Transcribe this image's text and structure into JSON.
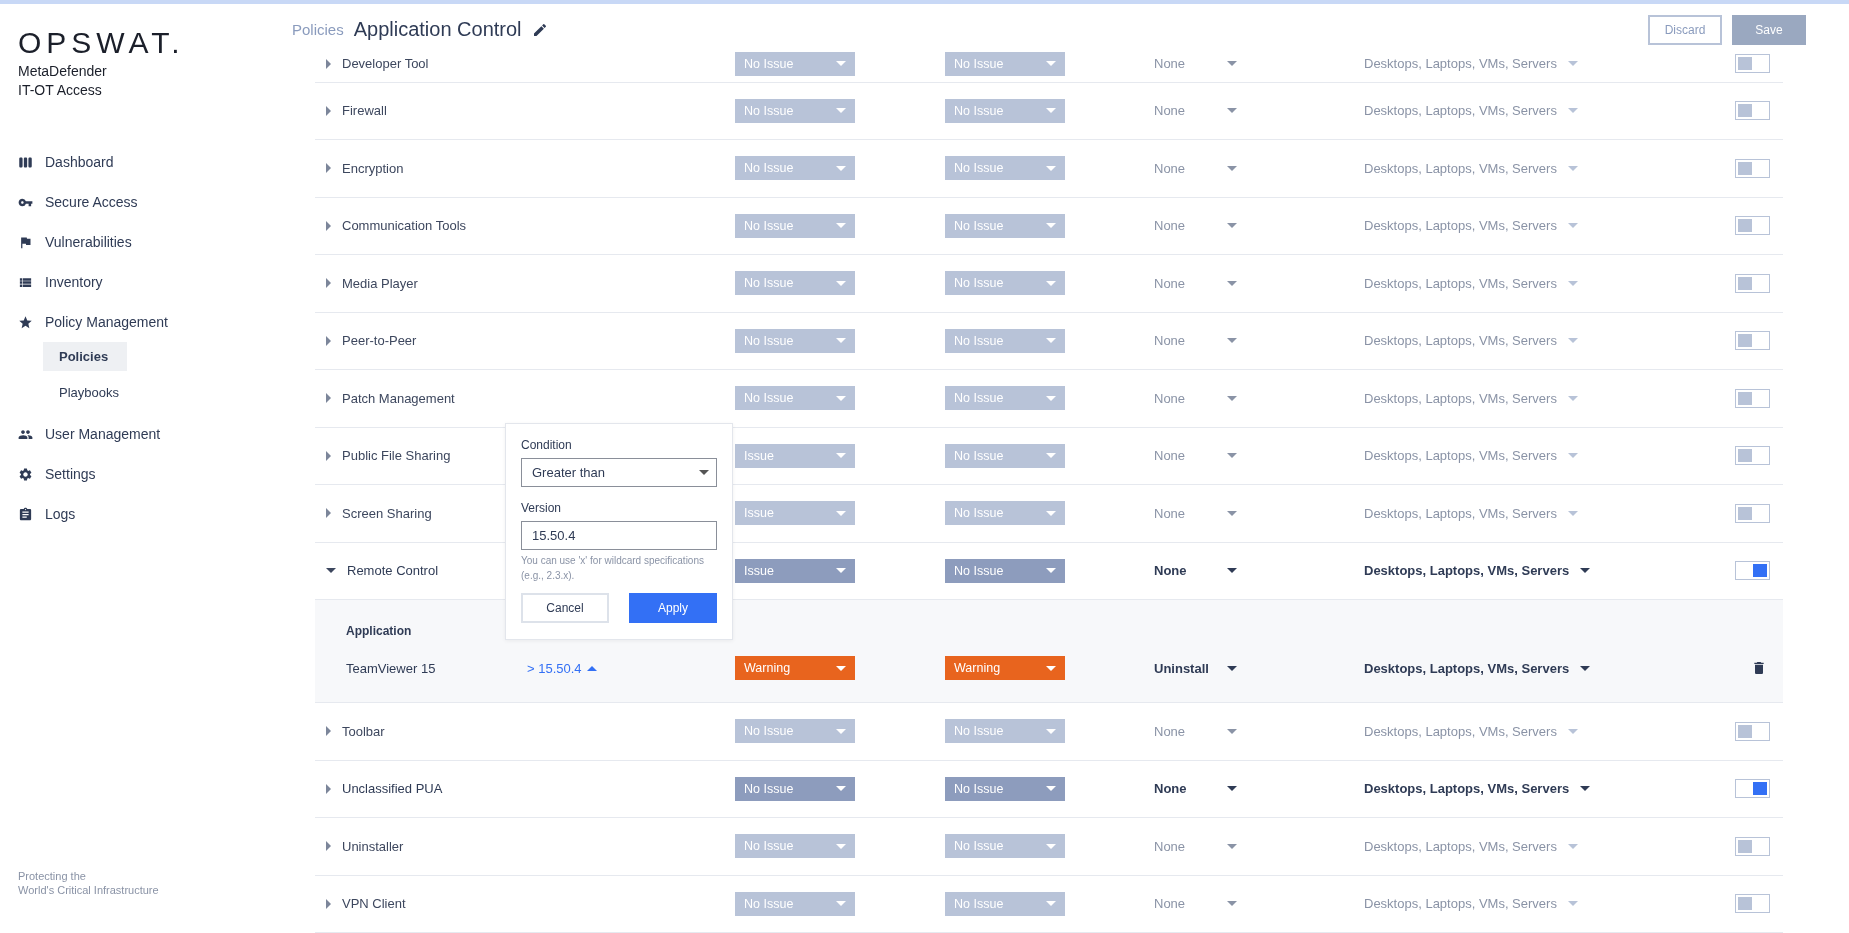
{
  "sidebar": {
    "logo": "OPSWAT.",
    "product": [
      "MetaDefender",
      "IT-OT Access"
    ],
    "nav": [
      {
        "label": "Dashboard",
        "selected": false
      },
      {
        "label": "Secure Access",
        "selected": false
      },
      {
        "label": "Vulnerabilities",
        "selected": false
      },
      {
        "label": "Inventory",
        "selected": false
      },
      {
        "label": "Policy Management",
        "selected": false,
        "children": [
          {
            "label": "Policies",
            "selected": true
          },
          {
            "label": "Playbooks",
            "selected": false
          }
        ]
      },
      {
        "label": "User Management",
        "selected": false
      },
      {
        "label": "Settings",
        "selected": false
      },
      {
        "label": "Logs",
        "selected": false
      }
    ],
    "footer": [
      "Protecting the",
      "World's Critical Infrastructure"
    ]
  },
  "header": {
    "breadcrumb": "Policies",
    "title": "Application Control",
    "buttons": [
      {
        "label": "Discard",
        "disabled": false
      },
      {
        "label": "Save",
        "disabled": true
      }
    ]
  },
  "rows": [
    {
      "name": "Developer Tool",
      "expanded": false,
      "on": false,
      "severity": [
        {
          "label": "No Issue",
          "kind": "ok"
        },
        {
          "label": "No Issue",
          "kind": "ok"
        }
      ],
      "action": "None",
      "platforms": "Desktops, Laptops, VMs, Servers"
    },
    {
      "name": "Firewall",
      "expanded": false,
      "on": false,
      "severity": [
        {
          "label": "No Issue",
          "kind": "ok"
        },
        {
          "label": "No Issue",
          "kind": "ok"
        }
      ],
      "action": "None",
      "platforms": "Desktops, Laptops, VMs, Servers"
    },
    {
      "name": "Encryption",
      "expanded": false,
      "on": false,
      "severity": [
        {
          "label": "No Issue",
          "kind": "ok"
        },
        {
          "label": "No Issue",
          "kind": "ok"
        }
      ],
      "action": "None",
      "platforms": "Desktops, Laptops, VMs, Servers"
    },
    {
      "name": "Communication Tools",
      "expanded": false,
      "on": false,
      "severity": [
        {
          "label": "No Issue",
          "kind": "ok"
        },
        {
          "label": "No Issue",
          "kind": "ok"
        }
      ],
      "action": "None",
      "platforms": "Desktops, Laptops, VMs, Servers"
    },
    {
      "name": "Media Player",
      "expanded": false,
      "on": false,
      "severity": [
        {
          "label": "No Issue",
          "kind": "ok"
        },
        {
          "label": "No Issue",
          "kind": "ok"
        }
      ],
      "action": "None",
      "platforms": "Desktops, Laptops, VMs, Servers"
    },
    {
      "name": "Peer-to-Peer",
      "expanded": false,
      "on": false,
      "severity": [
        {
          "label": "No Issue",
          "kind": "ok"
        },
        {
          "label": "No Issue",
          "kind": "ok"
        }
      ],
      "action": "None",
      "platforms": "Desktops, Laptops, VMs, Servers"
    },
    {
      "name": "Patch Management",
      "expanded": false,
      "on": false,
      "severity": [
        {
          "label": "No Issue",
          "kind": "ok"
        },
        {
          "label": "No Issue",
          "kind": "ok"
        }
      ],
      "action": "None",
      "platforms": "Desktops, Laptops, VMs, Servers"
    },
    {
      "name": "Public File Sharing",
      "expanded": false,
      "on": false,
      "severity": [
        {
          "label": "Issue",
          "kind": "ok"
        },
        {
          "label": "No Issue",
          "kind": "ok"
        }
      ],
      "action": "None",
      "platforms": "Desktops, Laptops, VMs, Servers"
    },
    {
      "name": "Screen Sharing",
      "expanded": false,
      "on": false,
      "severity": [
        {
          "label": "Issue",
          "kind": "ok"
        },
        {
          "label": "No Issue",
          "kind": "ok"
        }
      ],
      "action": "None",
      "platforms": "Desktops, Laptops, VMs, Servers"
    },
    {
      "name": "Remote Control",
      "expanded": true,
      "on": true,
      "severity": [
        {
          "label": "Issue",
          "kind": "ok"
        },
        {
          "label": "No Issue",
          "kind": "ok"
        }
      ],
      "action": "None",
      "platforms": "Desktops, Laptops, VMs, Servers",
      "detail": {
        "heading": "Application",
        "apps": [
          {
            "name": "TeamViewer 15",
            "version": "> 15.50.4",
            "severity": [
              {
                "label": "Warning",
                "kind": "warning"
              },
              {
                "label": "Warning",
                "kind": "warning"
              }
            ],
            "action": "Uninstall",
            "platforms": "Desktops, Laptops, VMs, Servers"
          }
        ]
      }
    },
    {
      "name": "Toolbar",
      "expanded": false,
      "on": false,
      "severity": [
        {
          "label": "No Issue",
          "kind": "ok"
        },
        {
          "label": "No Issue",
          "kind": "ok"
        }
      ],
      "action": "None",
      "platforms": "Desktops, Laptops, VMs, Servers"
    },
    {
      "name": "Unclassified PUA",
      "expanded": false,
      "on": true,
      "severity": [
        {
          "label": "No Issue",
          "kind": "ok"
        },
        {
          "label": "No Issue",
          "kind": "ok"
        }
      ],
      "action": "None",
      "platforms": "Desktops, Laptops, VMs, Servers"
    },
    {
      "name": "Uninstaller",
      "expanded": false,
      "on": false,
      "severity": [
        {
          "label": "No Issue",
          "kind": "ok"
        },
        {
          "label": "No Issue",
          "kind": "ok"
        }
      ],
      "action": "None",
      "platforms": "Desktops, Laptops, VMs, Servers"
    },
    {
      "name": "VPN Client",
      "expanded": false,
      "on": false,
      "severity": [
        {
          "label": "No Issue",
          "kind": "ok"
        },
        {
          "label": "No Issue",
          "kind": "ok"
        }
      ],
      "action": "None",
      "platforms": "Desktops, Laptops, VMs, Servers"
    }
  ],
  "popover": {
    "condition_label": "Condition",
    "condition": "Greater than",
    "version_label": "Version",
    "version": "15.50.4",
    "hint": "You can use 'x' for wildcard specifications (e.g., 2.3.x).",
    "buttons": [
      "Cancel",
      "Apply"
    ]
  }
}
